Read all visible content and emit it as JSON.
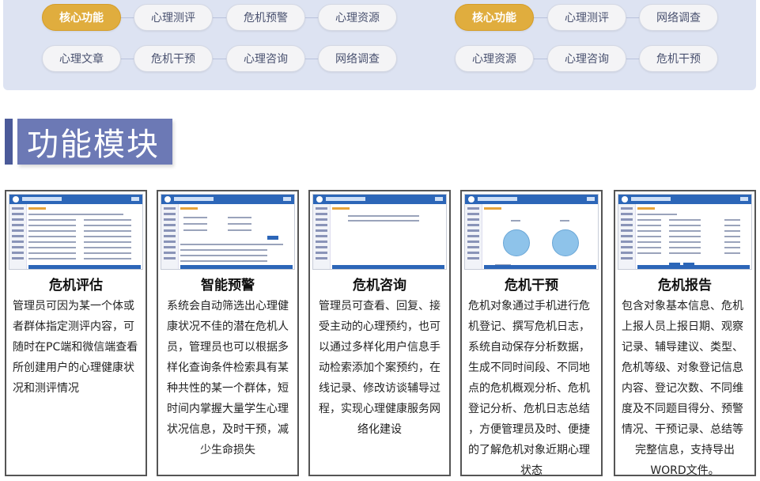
{
  "nav_left": {
    "row1": [
      "核心功能",
      "心理测评",
      "危机预警",
      "心理资源"
    ],
    "row2": [
      "心理文章",
      "危机干预",
      "心理咨询",
      "网络调查"
    ],
    "active": "核心功能"
  },
  "nav_right": {
    "row1": [
      "核心功能",
      "心理测评",
      "网络调查"
    ],
    "row2": [
      "心理资源",
      "心理咨询",
      "危机干预"
    ],
    "active": "核心功能"
  },
  "section": {
    "title": "功能模块"
  },
  "cards": [
    {
      "title": "危机评估",
      "lines": [
        "管理员可因为某一个体或",
        "者群体指定测评内容，可",
        "随时在PC端和微信端查看",
        "所创建用户的心理健康状",
        "况和测评情况"
      ]
    },
    {
      "title": "智能预警",
      "lines": [
        "系统会自动筛选出心理健",
        "康状况不佳的潜在危机人",
        "员，管理员也可以根据多",
        "样化查询条件检索具有某",
        "种共性的某一个群体，短",
        "时间内掌握大量学生心理",
        "状况信息，及时干预，减",
        "少生命损失"
      ]
    },
    {
      "title": "危机咨询",
      "lines": [
        "管理员可查看、回复、接",
        "受主动的心理预约，也可",
        "以通过多样化用户信息手",
        "动检索添加个案预约，在",
        "线记录、修改访谈辅导过",
        "程，实现心理健康服务网",
        "络化建设"
      ]
    },
    {
      "title": "危机干预",
      "lines": [
        "危机对象通过手机进行危",
        "机登记、撰写危机日志，",
        "系统自动保存分析数据，",
        "生成不同时间段、不同地",
        "点的危机概观分析、危机",
        "登记分析、危机日志总结",
        "，方便管理员及时、便捷",
        "的了解危机对象近期心理",
        "状态"
      ]
    },
    {
      "title": "危机报告",
      "lines": [
        "包含对象基本信息、危机",
        "上报人员上报日期、观察",
        "记录、辅导建议、类型、",
        "危机等级、对象登记信息",
        "内容、登记次数、不同维",
        "度及不同题目得分、预警",
        "情况、干预记录、总结等",
        "完整信息，支持导出",
        "WORD文件。"
      ]
    }
  ]
}
